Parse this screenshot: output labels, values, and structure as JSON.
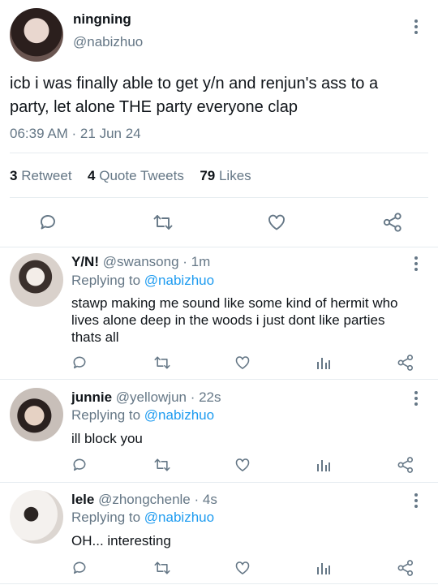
{
  "main_tweet": {
    "display_name": "ningning",
    "handle": "@nabizhuo",
    "text_line1": "icb i was finally able to get y/n and renjun's ass to a",
    "text_line2": "party, let alone THE party everyone clap",
    "timestamp": "06:39 AM · 21 Jun 24",
    "stats": {
      "retweets": "3",
      "retweets_label": "Retweet",
      "quotes": "4",
      "quotes_label": "Quote Tweets",
      "likes": "79",
      "likes_label": "Likes"
    }
  },
  "replies": [
    {
      "display_name": "Y/N!",
      "handle_time": "@swansong · 1m",
      "replying_label": "Replying to",
      "replying_to": "@nabizhuo",
      "text_lines": [
        "stawp making me sound like some kind of hermit who",
        "lives alone deep in the woods i just dont like parties",
        "thats all"
      ]
    },
    {
      "display_name": "junnie",
      "handle_time": "@yellowjun · 22s",
      "replying_label": "Replying to",
      "replying_to": "@nabizhuo",
      "text_lines": [
        "ill block you"
      ]
    },
    {
      "display_name": "lele",
      "handle_time": "@zhongchenle · 4s",
      "replying_label": "Replying to",
      "replying_to": "@nabizhuo",
      "text_lines": [
        "OH... interesting"
      ]
    }
  ],
  "icons": [
    "reply-icon",
    "retweet-icon",
    "like-icon",
    "share-icon",
    "analytics-icon",
    "more-icon"
  ],
  "colors": {
    "accent": "#1d9bf0",
    "muted": "#657786",
    "divider": "#e6ecf0"
  }
}
